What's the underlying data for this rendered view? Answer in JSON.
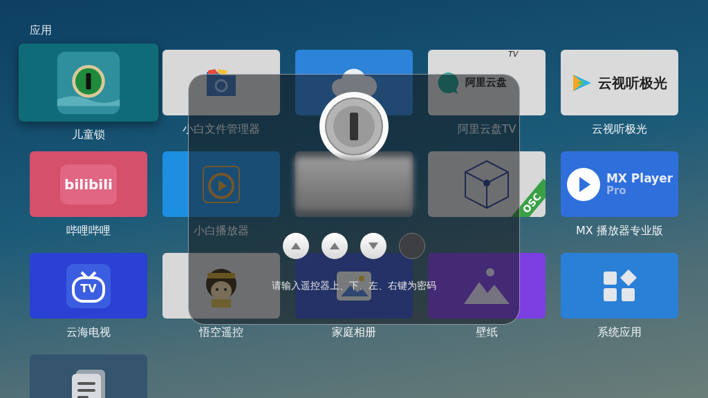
{
  "section_title": "应用",
  "apps": [
    {
      "label": "儿童锁",
      "focused": true
    },
    {
      "label": "小白文件管理器",
      "focused": false
    },
    {
      "focused": false
    },
    {
      "label": "阿里云盘TV",
      "logo": "阿里云盘",
      "logo_sup": "TV",
      "focused": false
    },
    {
      "label": "云视听极光",
      "logo": "云视听极光",
      "focused": false
    },
    {
      "label": "哔哩哔哩",
      "logo": "bilibili",
      "focused": false
    },
    {
      "label": "小白播放器",
      "focused": false
    },
    {
      "focused": false
    },
    {
      "badge": "OSC",
      "focused": false
    },
    {
      "label": "MX 播放器专业版",
      "logo": "MX Player",
      "logo_sub": "Pro",
      "focused": false
    },
    {
      "label": "云海电视",
      "logo": "TV",
      "focused": false
    },
    {
      "label": "悟空遥控",
      "focused": false
    },
    {
      "label": "家庭相册",
      "focused": false
    },
    {
      "label": "壁纸",
      "focused": false
    },
    {
      "label": "系统应用",
      "focused": false
    },
    {
      "focused": false
    }
  ],
  "dialog": {
    "keys": [
      {
        "kind": "up"
      },
      {
        "kind": "up"
      },
      {
        "kind": "down"
      },
      {
        "kind": "empty"
      }
    ],
    "hint": "请输入遥控器上、下、左、右键为密码"
  }
}
